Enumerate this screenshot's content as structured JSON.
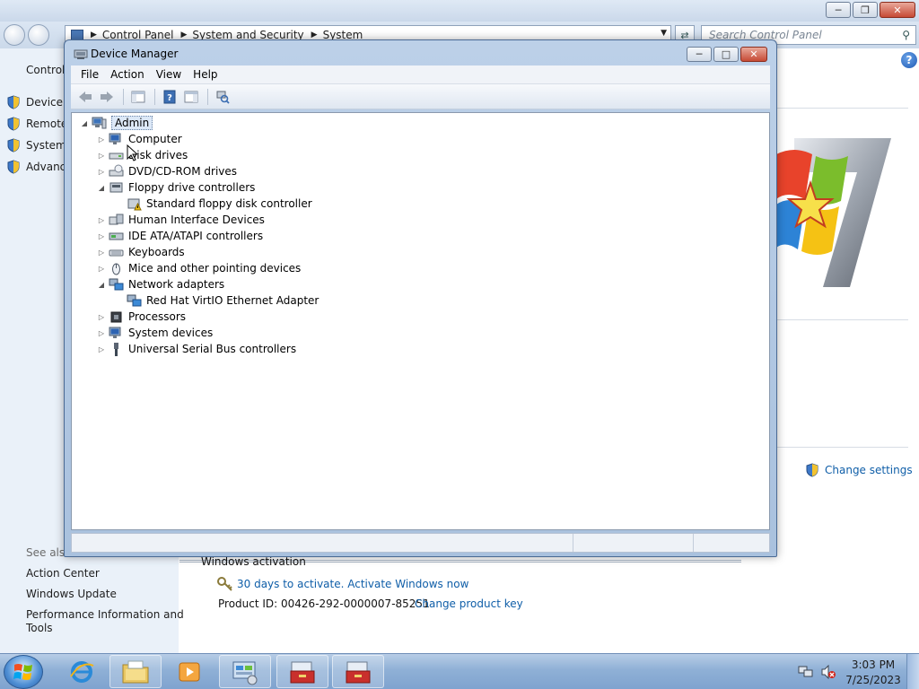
{
  "control_panel": {
    "address": {
      "crumbs": [
        "Control Panel",
        "System and Security",
        "System"
      ]
    },
    "search_placeholder": "Search Control Panel",
    "left": {
      "home": "Control",
      "items": [
        "Device M",
        "Remote",
        "System",
        "Advance"
      ],
      "see_also": "See also",
      "see_also_links": [
        "Action Center",
        "Windows Update",
        "Performance Information and",
        "Tools"
      ]
    },
    "change_settings": "Change settings",
    "activation_title": "Windows activation",
    "activate_link": "30 days to activate. Activate Windows now",
    "product_id": "Product ID: 00426-292-0000007-85251",
    "change_key": "Change product key"
  },
  "device_manager": {
    "title": "Device Manager",
    "menu": [
      "File",
      "Action",
      "View",
      "Help"
    ],
    "tree": {
      "root": "Admin",
      "items": [
        {
          "label": "Computer",
          "state": "collapsed",
          "icon": "computer-icon"
        },
        {
          "label": "Disk drives",
          "state": "collapsed",
          "icon": "disk-drive-icon"
        },
        {
          "label": "DVD/CD-ROM drives",
          "state": "collapsed",
          "icon": "dvd-drive-icon"
        },
        {
          "label": "Floppy drive controllers",
          "state": "expanded",
          "icon": "floppy-controller-icon"
        },
        {
          "label": "Standard floppy disk controller",
          "state": "child",
          "icon": "floppy-device-warning-icon"
        },
        {
          "label": "Human Interface Devices",
          "state": "collapsed",
          "icon": "hid-icon"
        },
        {
          "label": "IDE ATA/ATAPI controllers",
          "state": "collapsed",
          "icon": "ide-controller-icon"
        },
        {
          "label": "Keyboards",
          "state": "collapsed",
          "icon": "keyboard-icon"
        },
        {
          "label": "Mice and other pointing devices",
          "state": "collapsed",
          "icon": "mouse-icon"
        },
        {
          "label": "Network adapters",
          "state": "expanded",
          "icon": "network-adapter-icon"
        },
        {
          "label": "Red Hat VirtIO Ethernet Adapter",
          "state": "child",
          "icon": "ethernet-adapter-icon"
        },
        {
          "label": "Processors",
          "state": "collapsed",
          "icon": "processor-icon"
        },
        {
          "label": "System devices",
          "state": "collapsed",
          "icon": "system-devices-icon"
        },
        {
          "label": "Universal Serial Bus controllers",
          "state": "collapsed",
          "icon": "usb-icon"
        }
      ]
    }
  },
  "taskbar": {
    "clock_time": "3:03 PM",
    "clock_date": "7/25/2023"
  }
}
